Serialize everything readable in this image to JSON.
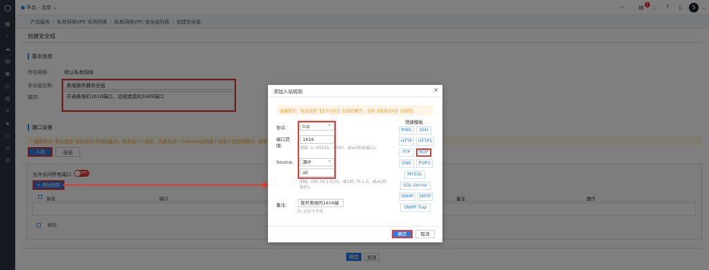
{
  "colors": {
    "primary": "#2c7be5",
    "highlight": "#e53935",
    "warning": "#e6a23c",
    "sidebar": "#2b3340"
  },
  "topbar": {
    "region": "华北 – 北京",
    "notification_count": "1",
    "avatar_letter": "S"
  },
  "breadcrumb": [
    "产品服务",
    "私有网络VPC-实例列表",
    "私有网络VPC-安全组列表",
    "创建安全组"
  ],
  "page": {
    "title": "创建安全组",
    "basic_section": "基本信息",
    "network_label": "所在网络:",
    "network_value": "默认私有网络",
    "name_label": "安全组名称:",
    "name_value": "奥维服务器安全组",
    "desc_label": "描述:",
    "desc_value": "开通奥维的1616端口、远程连接的3389端口",
    "port_section": "端口设置",
    "warning": "* 温馨提示: 安全组是\"允许访问\"的规则集合，每添加一个规则，代表允许一个source访问某个或某个范围的端口，若安",
    "tab_in": "入站",
    "tab_out": "出站",
    "allow_all_label": "允许访问所有端口:",
    "toggle_text": "OFF",
    "add_rule": "+ 添加规则",
    "table_headers": [
      "协议",
      "端口",
      "备注",
      "操作"
    ],
    "delete": "删除",
    "ok": "确定",
    "cancel": "取消"
  },
  "modal": {
    "title": "添加入站规则",
    "close": "×",
    "tip": "温馨提示：安全组是【允许访问】的规则集合，没有【拒绝访问】的规则。",
    "protocol_label": "协议:",
    "protocol_value": "tcp",
    "port_label": "端口范围:",
    "port_value": "1616",
    "port_hint": "例如: 1~65535、8080、或all(所有端口)。",
    "source_label": "Source:",
    "source_value": "源IP",
    "source_input": "all",
    "source_hint": "例如: 180.76.1.0/24、或180.76.1.0、或all(所有IP)。",
    "remark_label": "备注:",
    "remark_value": "放开奥维的1616端",
    "remark_hint": "0~255个字符",
    "quick_title": "快捷模板",
    "quick": [
      "PING",
      "SSH",
      "HTTP",
      "HTTPS",
      "FTP",
      "RDP",
      "DNS",
      "POP3",
      "MYSQL",
      "SQL Server",
      "SNMP",
      "SMTP",
      "SNMP Trap"
    ],
    "ok": "确定",
    "cancel": "取消"
  }
}
